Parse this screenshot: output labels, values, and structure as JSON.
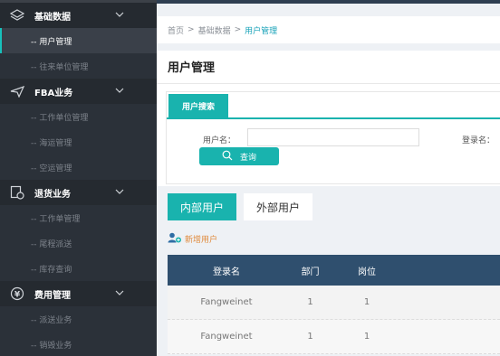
{
  "sidebar": {
    "groups": [
      {
        "label": "基础数据",
        "icon": "layers-icon",
        "items": [
          "-- 用户管理",
          "-- 往来单位管理"
        ]
      },
      {
        "label": "FBA业务",
        "icon": "plane-icon",
        "items": [
          "-- 工作单位管理",
          "-- 海运管理",
          "-- 空运管理"
        ]
      },
      {
        "label": "退货业务",
        "icon": "return-icon",
        "items": [
          "-- 工作单管理",
          "-- 尾程派送",
          "-- 库存查询"
        ]
      },
      {
        "label": "费用管理",
        "icon": "yen-icon",
        "items": [
          "-- 派送业务",
          "-- 销毁业务"
        ]
      }
    ],
    "active_item": "-- 用户管理"
  },
  "breadcrumb": {
    "home": "首页",
    "sep": ">",
    "mid": "基础数据",
    "current": "用户管理"
  },
  "panel": {
    "title": "用户管理"
  },
  "search": {
    "tab": "用户搜索",
    "username_label": "用户名：",
    "username_value": "",
    "login_label": "登录名：",
    "query_button": "查询"
  },
  "tabs": {
    "internal": "内部用户",
    "external": "外部用户"
  },
  "actions": {
    "add_user": "新增用户"
  },
  "table": {
    "headers": [
      "登录名",
      "部门",
      "岗位"
    ],
    "rows": [
      [
        "Fangweinet",
        "1",
        "1"
      ],
      [
        "Fangweinet",
        "1",
        "1"
      ]
    ]
  },
  "colors": {
    "accent": "#19b3ae",
    "sidebar": "#2b3139",
    "table_header": "#2f4f6e",
    "add_link": "#e08a3c"
  }
}
